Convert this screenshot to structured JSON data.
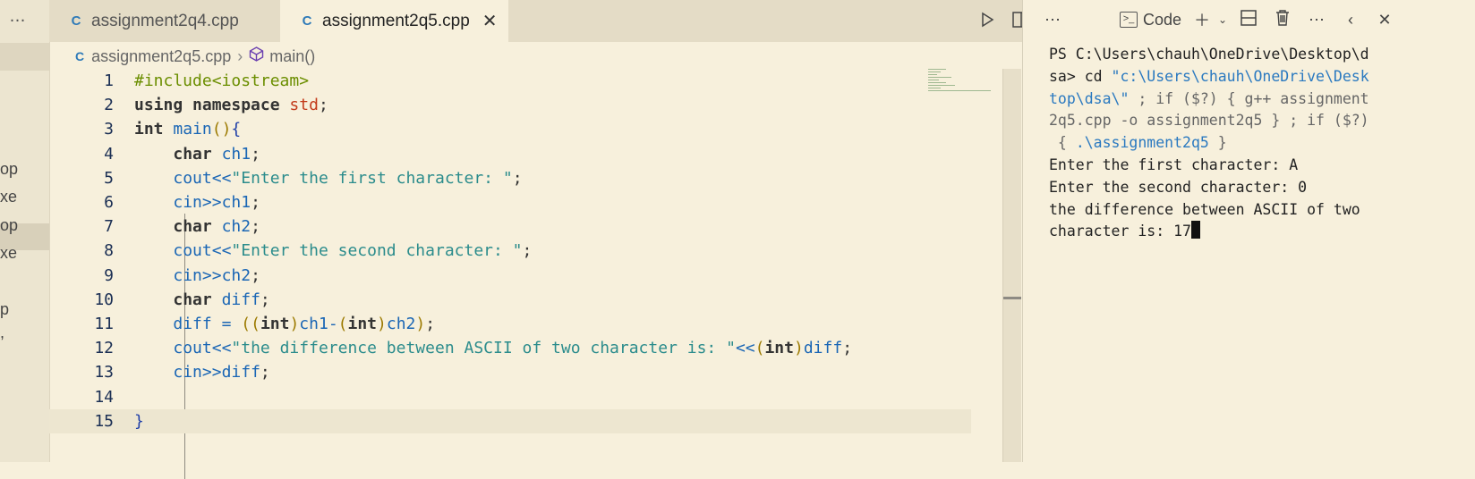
{
  "left_panel": {
    "overflow_icon": "…",
    "fragments": [
      "op",
      "xe",
      "op",
      "xe",
      "p",
      ","
    ]
  },
  "tabs": [
    {
      "label": "assignment2q4.cpp",
      "active": false
    },
    {
      "label": "assignment2q5.cpp",
      "active": true
    }
  ],
  "editor_actions": [
    "run-icon",
    "split-editor-icon",
    "more-icon"
  ],
  "breadcrumb": {
    "file": "assignment2q5.cpp",
    "symbol": "main()"
  },
  "code_lines": [
    {
      "n": "1",
      "text": "#include<iostream>"
    },
    {
      "n": "2",
      "text": "using namespace std;"
    },
    {
      "n": "3",
      "text": "int main(){"
    },
    {
      "n": "4",
      "text": "    char ch1;"
    },
    {
      "n": "5",
      "text": "    cout<<\"Enter the first character: \";"
    },
    {
      "n": "6",
      "text": "    cin>>ch1;"
    },
    {
      "n": "7",
      "text": "    char ch2;"
    },
    {
      "n": "8",
      "text": "    cout<<\"Enter the second character: \";"
    },
    {
      "n": "9",
      "text": "    cin>>ch2;"
    },
    {
      "n": "10",
      "text": "    char diff;"
    },
    {
      "n": "11",
      "text": "    diff = ((int)ch1-(int)ch2);"
    },
    {
      "n": "12",
      "text": "    cout<<\"the difference between ASCII of two character is: \"<<(int)diff;"
    },
    {
      "n": "13",
      "text": "    cin>>diff;"
    },
    {
      "n": "14",
      "text": ""
    },
    {
      "n": "15",
      "text": "}"
    }
  ],
  "terminal": {
    "toolbar": {
      "name": "Code"
    },
    "lines": [
      "PS C:\\Users\\chauh\\OneDrive\\Desktop\\d",
      "sa> cd \"c:\\Users\\chauh\\OneDrive\\Desk",
      "top\\dsa\\\" ; if ($?) { g++ assignment",
      "2q5.cpp -o assignment2q5 } ; if ($?)",
      " { .\\assignment2q5 }",
      "Enter the first character: A",
      "Enter the second character: 0",
      "the difference between ASCII of two",
      "character is: 17"
    ]
  },
  "colors": {
    "background": "#f7f0dc",
    "keyword": "#333333",
    "variable": "#1a66b5",
    "string": "#2b8c8c",
    "preprocessor": "#6b8e00"
  }
}
